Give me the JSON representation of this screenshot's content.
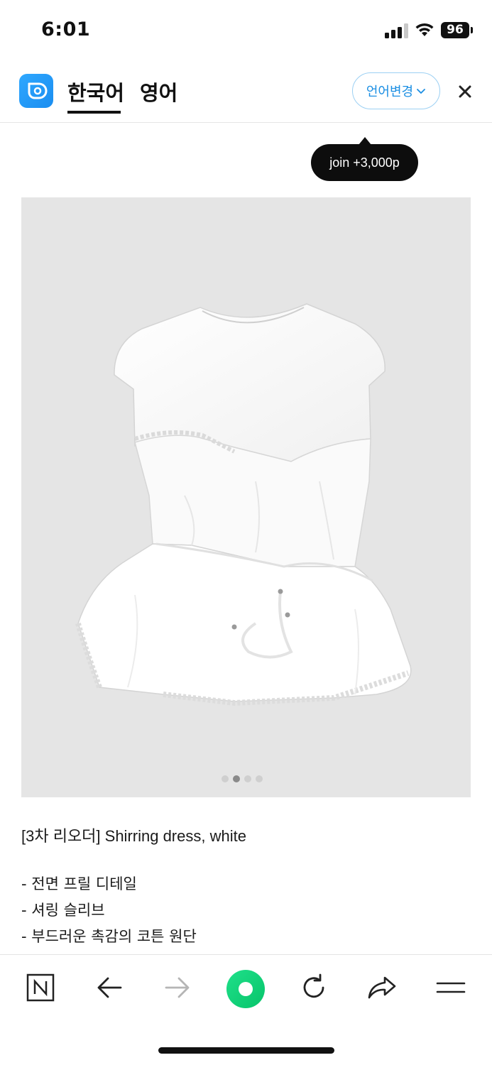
{
  "status_bar": {
    "time": "6:01",
    "battery": "96"
  },
  "translator": {
    "tab_korean": "한국어",
    "tab_english": "영어",
    "language_button": "언어변경",
    "accent_color": "#1c8fe3"
  },
  "tooltip": {
    "text": "join +3,000p"
  },
  "product": {
    "title": "[3차 리오더] Shirring dress, white",
    "carousel_dots": 4,
    "carousel_active_index": 1,
    "description": [
      "- 전면 프릴 디테일",
      "- 셔링 슬리브",
      "- 부드러운 촉감의 코튼 원단"
    ]
  },
  "toolbar": {
    "icons": [
      "naver-icon",
      "back-arrow-icon",
      "forward-arrow-icon",
      "green-dot-icon",
      "reload-icon",
      "share-icon",
      "menu-icon"
    ]
  }
}
